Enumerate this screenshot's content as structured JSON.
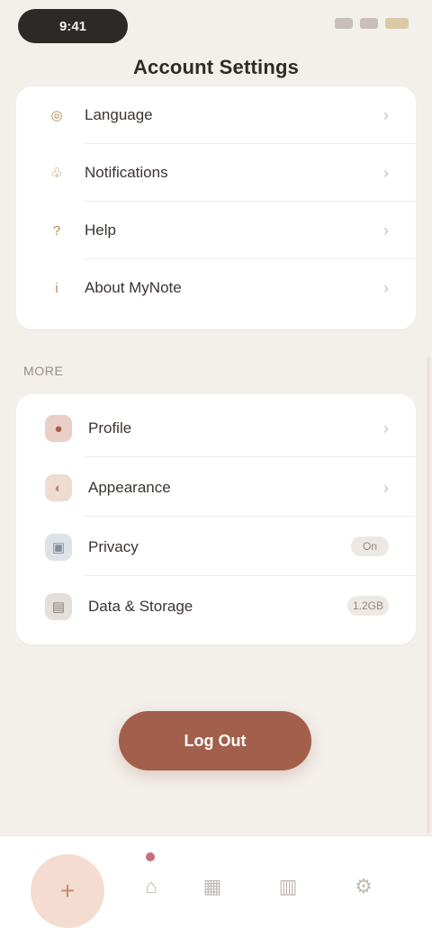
{
  "status": {
    "time": "9:41"
  },
  "page_title": "Account Settings",
  "top_items": [
    {
      "label": "Language",
      "icon": "globe-icon"
    },
    {
      "label": "Notifications",
      "icon": "bell-icon"
    },
    {
      "label": "Help",
      "icon": "question-icon"
    },
    {
      "label": "About MyNote",
      "icon": "info-icon"
    }
  ],
  "section_heading": "More",
  "bottom_items": [
    {
      "label": "Profile",
      "icon": "profile-icon"
    },
    {
      "label": "Appearance",
      "icon": "palette-icon"
    },
    {
      "label": "Privacy",
      "icon": "lock-icon",
      "badge": "On"
    },
    {
      "label": "Data & Storage",
      "icon": "storage-icon",
      "badge": "1.2GB"
    }
  ],
  "primary_button": "Log Out",
  "nav": {
    "items": [
      "home-icon",
      "calendar-icon",
      "stats-icon",
      "settings-icon"
    ]
  },
  "colors": {
    "background": "#f3efeb",
    "card": "#ffffff",
    "accent": "#a25f4b",
    "nav_fab": "#f4dcd0",
    "notification_dot": "#c86e7a"
  }
}
